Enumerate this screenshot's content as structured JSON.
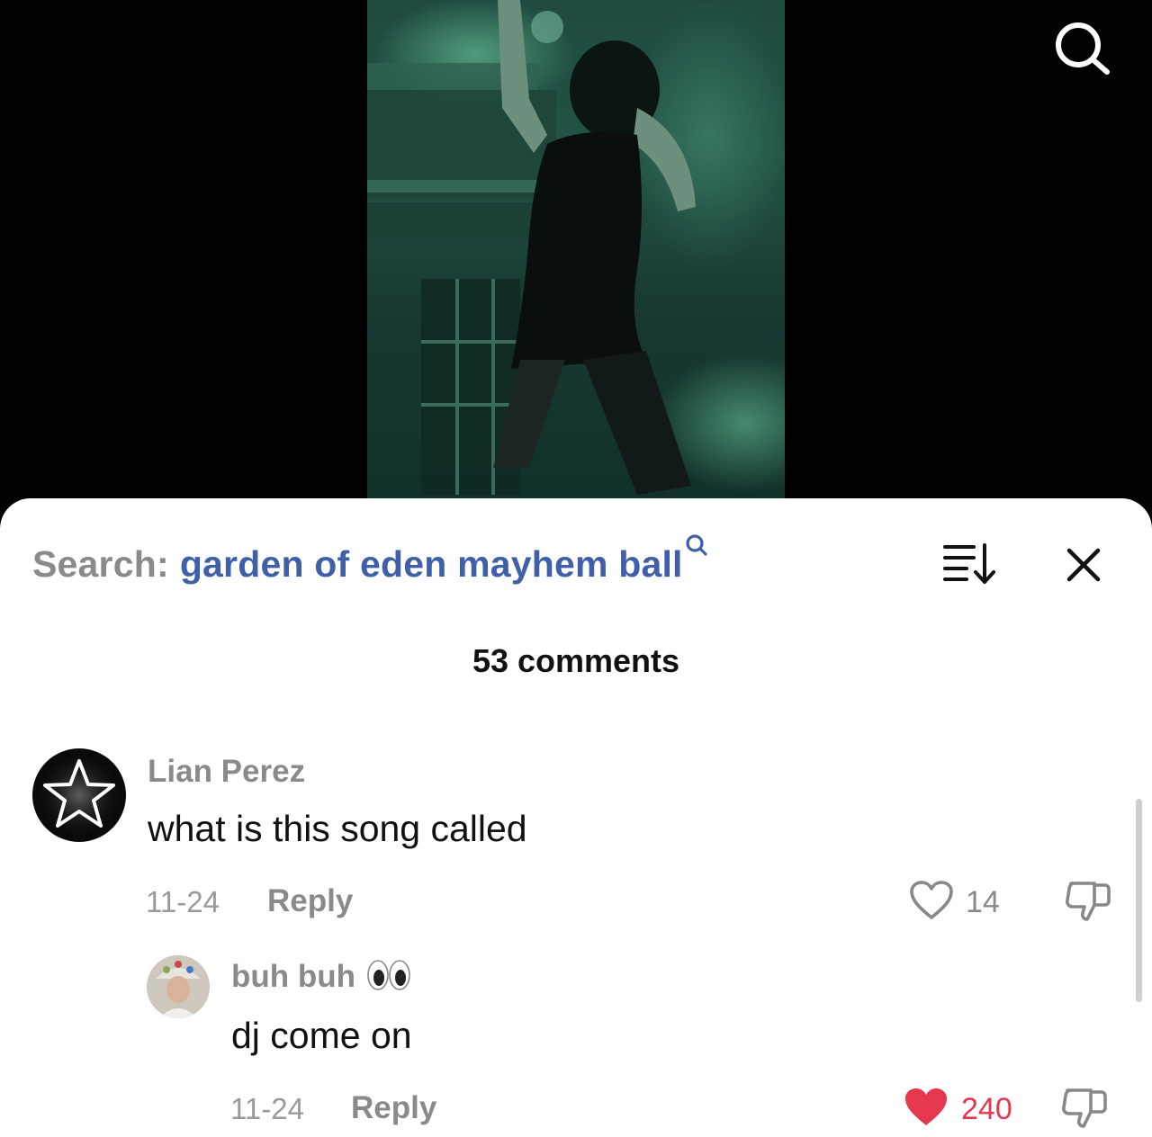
{
  "search_bar": {
    "prefix": "Search:",
    "query": "garden of eden mayhem ball"
  },
  "comments_header": {
    "count_label": "53 comments"
  },
  "comments": [
    {
      "author": "Lian Perez",
      "text": "what is this song called",
      "date": "11-24",
      "reply_label": "Reply",
      "likes": "14",
      "liked": false
    },
    {
      "author": "buh buh",
      "author_emoji": "eyes",
      "text": "dj come on",
      "date": "11-24",
      "reply_label": "Reply",
      "likes": "240",
      "liked": true
    }
  ],
  "colors": {
    "query_blue": "#3f5fa8",
    "like_red": "#e5384f",
    "muted_gray": "#8a8a8a"
  },
  "icons": [
    "search-icon",
    "sort-icon",
    "close-icon",
    "heart-icon",
    "dislike-icon",
    "eyes-emoji-icon",
    "star-icon"
  ]
}
